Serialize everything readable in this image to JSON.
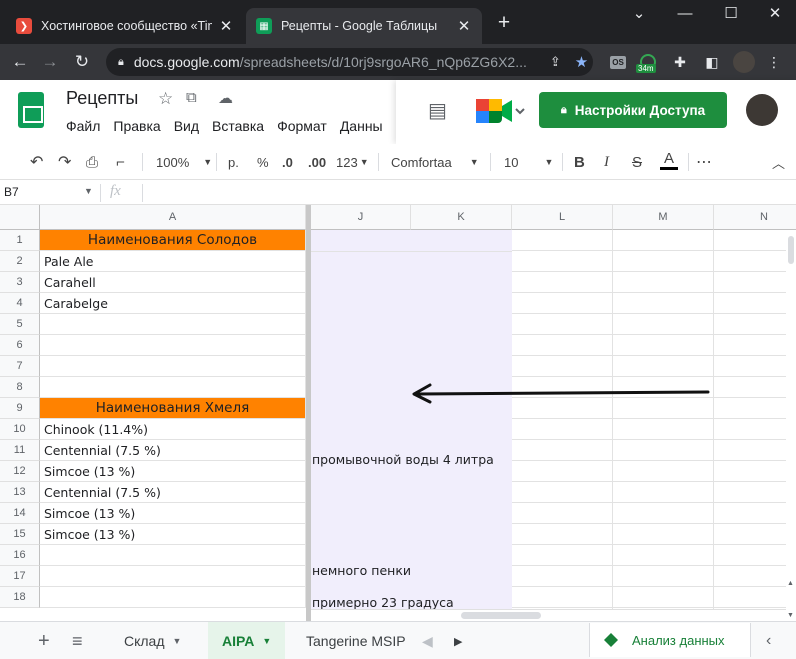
{
  "browser": {
    "tabs": [
      {
        "title": "Хостинговое сообщество «Time",
        "favicon": "timeweb-icon",
        "favicon_color": "#e84c3d",
        "active": false
      },
      {
        "title": "Рецепты - Google Таблицы",
        "favicon": "sheets-icon",
        "favicon_color": "#0f9d58",
        "active": true
      }
    ],
    "new_tab": "+",
    "url_host": "docs.google.com",
    "url_path": "/spreadsheets/d/10rj9srgoAR6_nQp6ZG6X2...",
    "ext_badge": "34m",
    "ext_os_label": "OS"
  },
  "docs": {
    "title": "Рецепты",
    "menu": [
      "Файл",
      "Правка",
      "Вид",
      "Вставка",
      "Формат",
      "Данны"
    ],
    "share_label": "Настройки Доступа"
  },
  "toolbar": {
    "zoom": "100%",
    "currency": "р.",
    "percent": "%",
    "dec_minus": ".0",
    "dec_plus": ".00",
    "number_format": "123",
    "font": "Comfortaa",
    "font_size": "10",
    "bold": "B",
    "italic": "I",
    "strike": "S",
    "text_color": "A",
    "more": "⋯"
  },
  "formula": {
    "cell_ref": "B7",
    "fx": "fx",
    "value": ""
  },
  "grid": {
    "columns": [
      "A",
      "J",
      "K",
      "L",
      "M",
      "N"
    ],
    "rows": [
      "1",
      "2",
      "3",
      "4",
      "5",
      "6",
      "7",
      "8",
      "9",
      "10",
      "11",
      "12",
      "13",
      "14",
      "15",
      "16",
      "17",
      "18"
    ],
    "colA": [
      "Наименования Солодов",
      "Pale Ale",
      "Carahell",
      "Carabelge",
      "",
      "",
      "",
      "",
      "Наименования Хмеля",
      "Chinook (11.4%)",
      "Centennial (7.5 %)",
      "Simcoe (13 %)",
      "Centennial (7.5 %)",
      "Simcoe (13 %)",
      "Simcoe (13 %)",
      "",
      "",
      ""
    ],
    "overflow": {
      "r11": "промывочной воды 4 литра",
      "r17": "немного пенки",
      "r18": "примерно 23 градуса"
    },
    "header_color": "#ff8200",
    "highlight_color": "#f1eefc"
  },
  "sheets": {
    "add": "+",
    "list": "≡",
    "tabs": [
      {
        "label": "Склад",
        "active": false
      },
      {
        "label": "AIPA",
        "active": true
      },
      {
        "label": "Tangerine MSIP",
        "active": false
      }
    ],
    "explore_label": "Анализ данных"
  }
}
